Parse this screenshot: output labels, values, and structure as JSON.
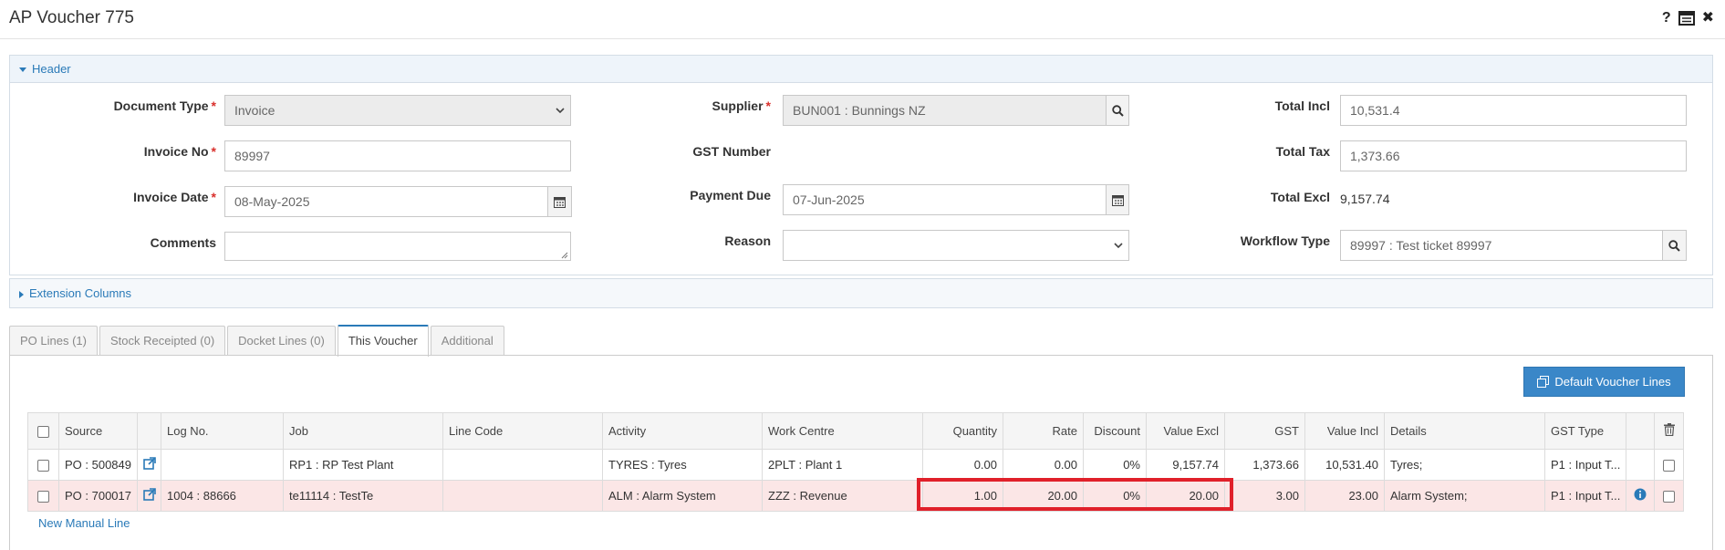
{
  "window": {
    "title": "AP Voucher 775",
    "help_glyph": "?",
    "close_glyph": "✖"
  },
  "header_panel": {
    "title": "Header",
    "document_type": {
      "label": "Document Type",
      "value": "Invoice"
    },
    "invoice_no": {
      "label": "Invoice No",
      "value": "89997"
    },
    "invoice_date": {
      "label": "Invoice Date",
      "value": "08-May-2025"
    },
    "comments": {
      "label": "Comments",
      "value": ""
    },
    "supplier": {
      "label": "Supplier",
      "value": "BUN001 : Bunnings NZ"
    },
    "gst_number": {
      "label": "GST Number",
      "value": ""
    },
    "payment_due": {
      "label": "Payment Due",
      "value": "07-Jun-2025"
    },
    "reason": {
      "label": "Reason",
      "value": ""
    },
    "total_incl": {
      "label": "Total Incl",
      "value": "10,531.4"
    },
    "total_tax": {
      "label": "Total Tax",
      "value": "1,373.66"
    },
    "total_excl": {
      "label": "Total Excl",
      "value": "9,157.74"
    },
    "workflow_type": {
      "label": "Workflow Type",
      "value": "89997 : Test ticket 89997"
    },
    "required_mark": "*"
  },
  "extension_panel": {
    "title": "Extension Columns"
  },
  "tabs": [
    {
      "label": "PO Lines (1)",
      "active": false
    },
    {
      "label": "Stock Receipted (0)",
      "active": false
    },
    {
      "label": "Docket Lines (0)",
      "active": false
    },
    {
      "label": "This Voucher",
      "active": true
    },
    {
      "label": "Additional",
      "active": false
    }
  ],
  "toolbar": {
    "default_lines_label": "Default Voucher Lines"
  },
  "table": {
    "columns": [
      "Source",
      "Log No.",
      "Job",
      "Line Code",
      "Activity",
      "Work Centre",
      "Quantity",
      "Rate",
      "Discount",
      "Value Excl",
      "GST",
      "Value Incl",
      "Details",
      "GST Type"
    ],
    "rows": [
      {
        "source": "PO : 500849",
        "log_no": "",
        "job": "RP1 : RP Test Plant",
        "line_code": "",
        "activity": "TYRES : Tyres",
        "work_centre": "2PLT : Plant 1",
        "quantity": "0.00",
        "rate": "0.00",
        "discount": "0%",
        "value_excl": "9,157.74",
        "gst": "1,373.66",
        "value_incl": "10,531.40",
        "details": "Tyres;",
        "gst_type": "P1 : Input T..."
      },
      {
        "source": "PO : 700017",
        "log_no": "1004 : 88666",
        "job": "te11114 : TestTe",
        "line_code": "",
        "activity": "ALM : Alarm System",
        "work_centre": "ZZZ : Revenue",
        "quantity": "1.00",
        "rate": "20.00",
        "discount": "0%",
        "value_excl": "20.00",
        "gst": "3.00",
        "value_incl": "23.00",
        "details": "Alarm System;",
        "gst_type": "P1 : Input T..."
      }
    ],
    "new_line_label": "New Manual Line"
  },
  "colors": {
    "accent": "#2a7ab8",
    "button": "#3a87c8",
    "row_highlight": "#fbe6e6",
    "annotation": "#e0202a",
    "required": "#d9302c"
  }
}
